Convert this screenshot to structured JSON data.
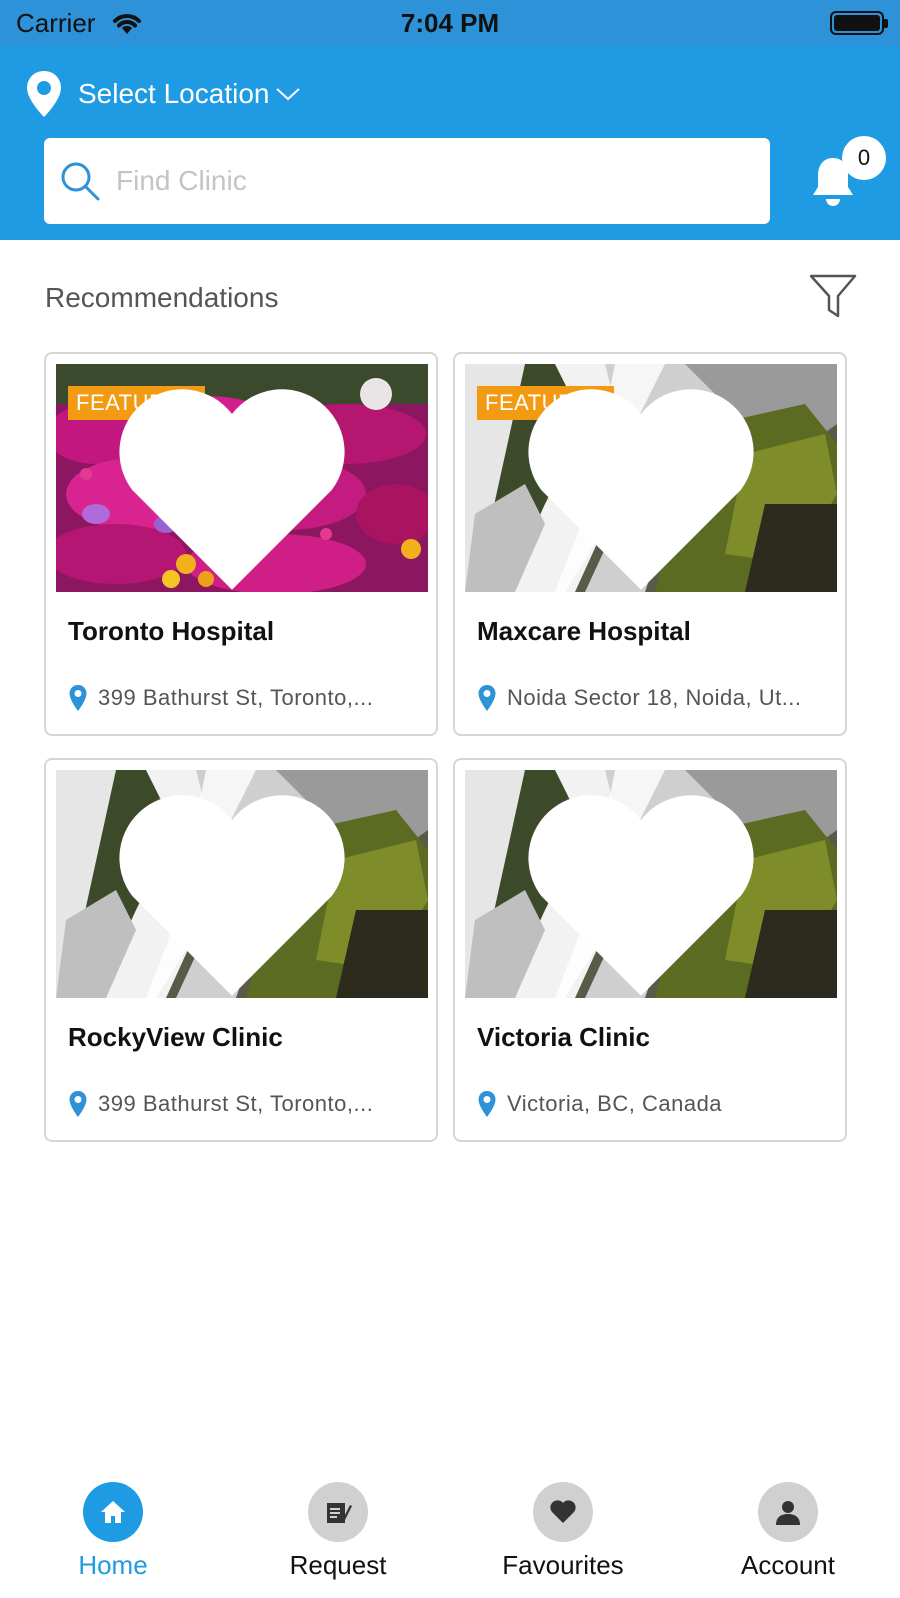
{
  "status_bar": {
    "carrier": "Carrier",
    "time": "7:04 PM"
  },
  "header": {
    "location_label": "Select Location",
    "search": {
      "placeholder": "Find Clinic",
      "value": ""
    },
    "notification_count": "0"
  },
  "section": {
    "title": "Recommendations"
  },
  "cards": [
    {
      "name": "Toronto Hospital",
      "address": "399 Bathurst St, Toronto,...",
      "badge": "FEATURED",
      "image": "flowers"
    },
    {
      "name": "Maxcare Hospital",
      "address": "Noida Sector 18, Noida, Ut...",
      "badge": "FEATURED",
      "image": "waterfall"
    },
    {
      "name": "RockyView Clinic",
      "address": "399 Bathurst St, Toronto,...",
      "badge": "",
      "image": "waterfall"
    },
    {
      "name": "Victoria Clinic",
      "address": "Victoria, BC, Canada",
      "badge": "",
      "image": "waterfall"
    }
  ],
  "bottom_nav": [
    {
      "label": "Home",
      "icon": "home-icon",
      "active": true
    },
    {
      "label": "Request",
      "icon": "request-icon",
      "active": false
    },
    {
      "label": "Favourites",
      "icon": "heart-icon",
      "active": false
    },
    {
      "label": "Account",
      "icon": "account-icon",
      "active": false
    }
  ],
  "colors": {
    "header_blue": "#1e9be3",
    "status_blue": "#2e92d8",
    "featured_orange": "#f39a13",
    "active_nav": "#1e9be3",
    "inactive_nav": "#d0d0d0"
  }
}
